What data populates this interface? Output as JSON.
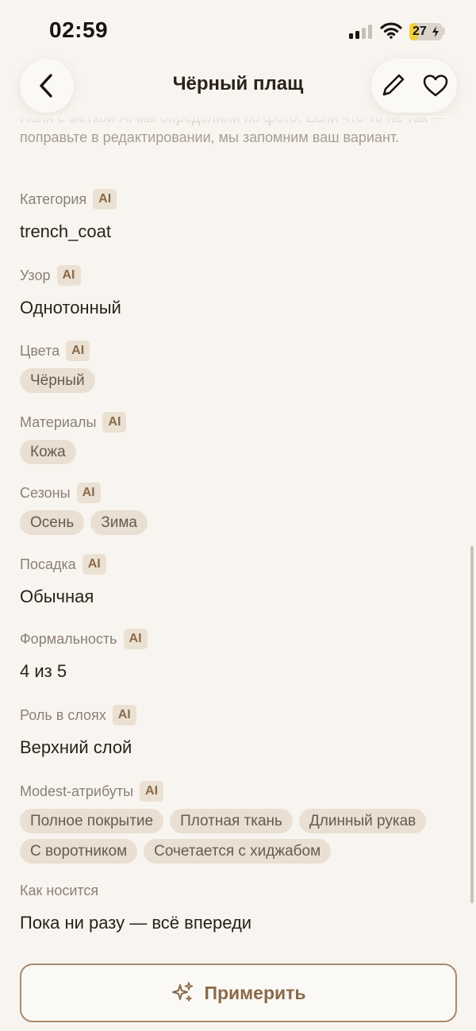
{
  "status_bar": {
    "time": "02:59",
    "battery": "27",
    "battery_fraction": 0.27,
    "battery_color": "#f2cf3c"
  },
  "nav": {
    "title": "Чёрный плащ",
    "icons": [
      "chevron-left-icon",
      "pencil-icon",
      "heart-icon"
    ]
  },
  "hint": "Поля с меткой AI мы определили по фото. Если что-то не так — поправьте в редактировании, мы запомним ваш вариант.",
  "ai_badge": "AI",
  "fields": {
    "category": {
      "label": "Категория",
      "value": "trench_coat"
    },
    "pattern": {
      "label": "Узор",
      "value": "Однотонный"
    },
    "colors": {
      "label": "Цвета",
      "chips": [
        "Чёрный"
      ]
    },
    "materials": {
      "label": "Материалы",
      "chips": [
        "Кожа"
      ]
    },
    "seasons": {
      "label": "Сезоны",
      "chips": [
        "Осень",
        "Зима"
      ]
    },
    "fit": {
      "label": "Посадка",
      "value": "Обычная"
    },
    "formality": {
      "label": "Формальность",
      "value": "4 из 5"
    },
    "layer_role": {
      "label": "Роль в слоях",
      "value": "Верхний слой"
    },
    "modest": {
      "label": "Modest-атрибуты",
      "chips": [
        "Полное покрытие",
        "Плотная ткань",
        "Длинный рукав",
        "С воротником",
        "Сочетается с хиджабом"
      ]
    },
    "worn": {
      "label": "Как носится",
      "value": "Пока ни разу — всё впереди"
    }
  },
  "try_on": {
    "label": "Примерить",
    "icon": "sparkles-icon"
  },
  "colors": {
    "background": "#f8f5f0",
    "accent": "#8a6a4a",
    "chip_bg": "#e9dfd2",
    "badge_bg": "#ebe1d3"
  }
}
